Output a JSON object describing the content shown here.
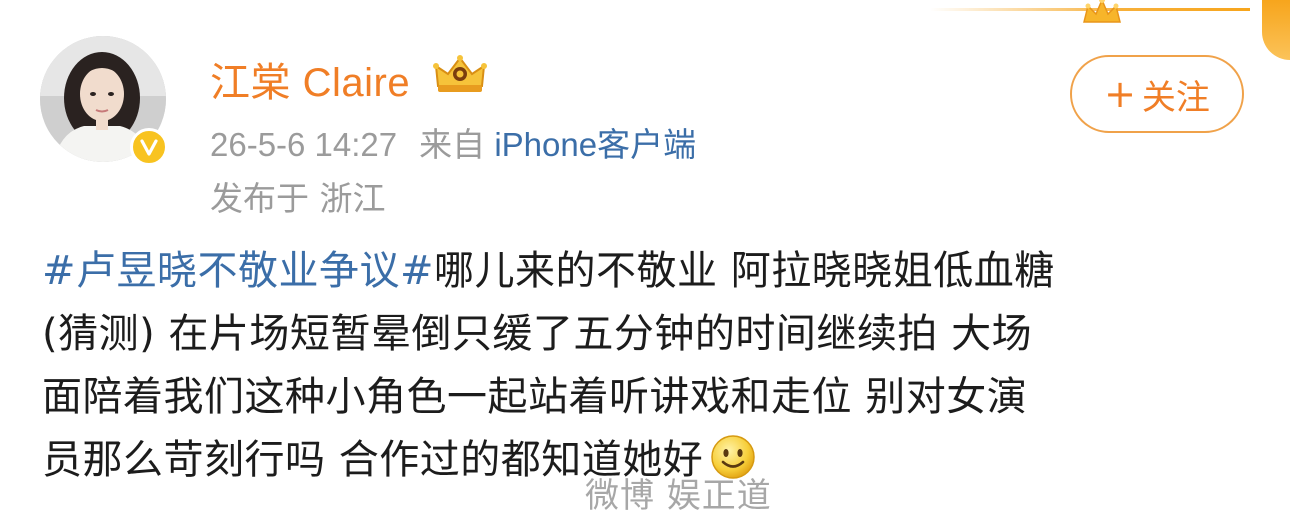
{
  "post": {
    "username": "江棠 Claire",
    "timestamp": "26-5-6 14:27",
    "source_prefix": "来自",
    "source_app": "iPhone客户端",
    "location": "发布于 浙江",
    "follow_label": "关注",
    "follow_plus": "+",
    "hashtag": "#卢昱晓不敬业争议#",
    "lines": [
      "哪儿来的不敬业 阿拉晓晓姐低血糖",
      "(猜测) 在片场短暂晕倒只缓了五分钟的时间继续拍 大场",
      "面陪着我们这种小角色一起站着听讲戏和走位 别对女演",
      "员那么苛刻行吗 合作过的都知道她好"
    ],
    "emoji": "smile-emoji",
    "watermark": "微博 娱正道"
  },
  "colors": {
    "username": "#f07e26",
    "link": "#3b6ea8",
    "meta": "#9b9b9b",
    "text": "#1c1c1c",
    "verified": "#f8c320",
    "follow_border": "#f0a24a"
  },
  "icons": {
    "verified_badge": "verified-v-icon",
    "vip_badge": "vip-crown-icon",
    "top_decoration": "crown-icon"
  }
}
